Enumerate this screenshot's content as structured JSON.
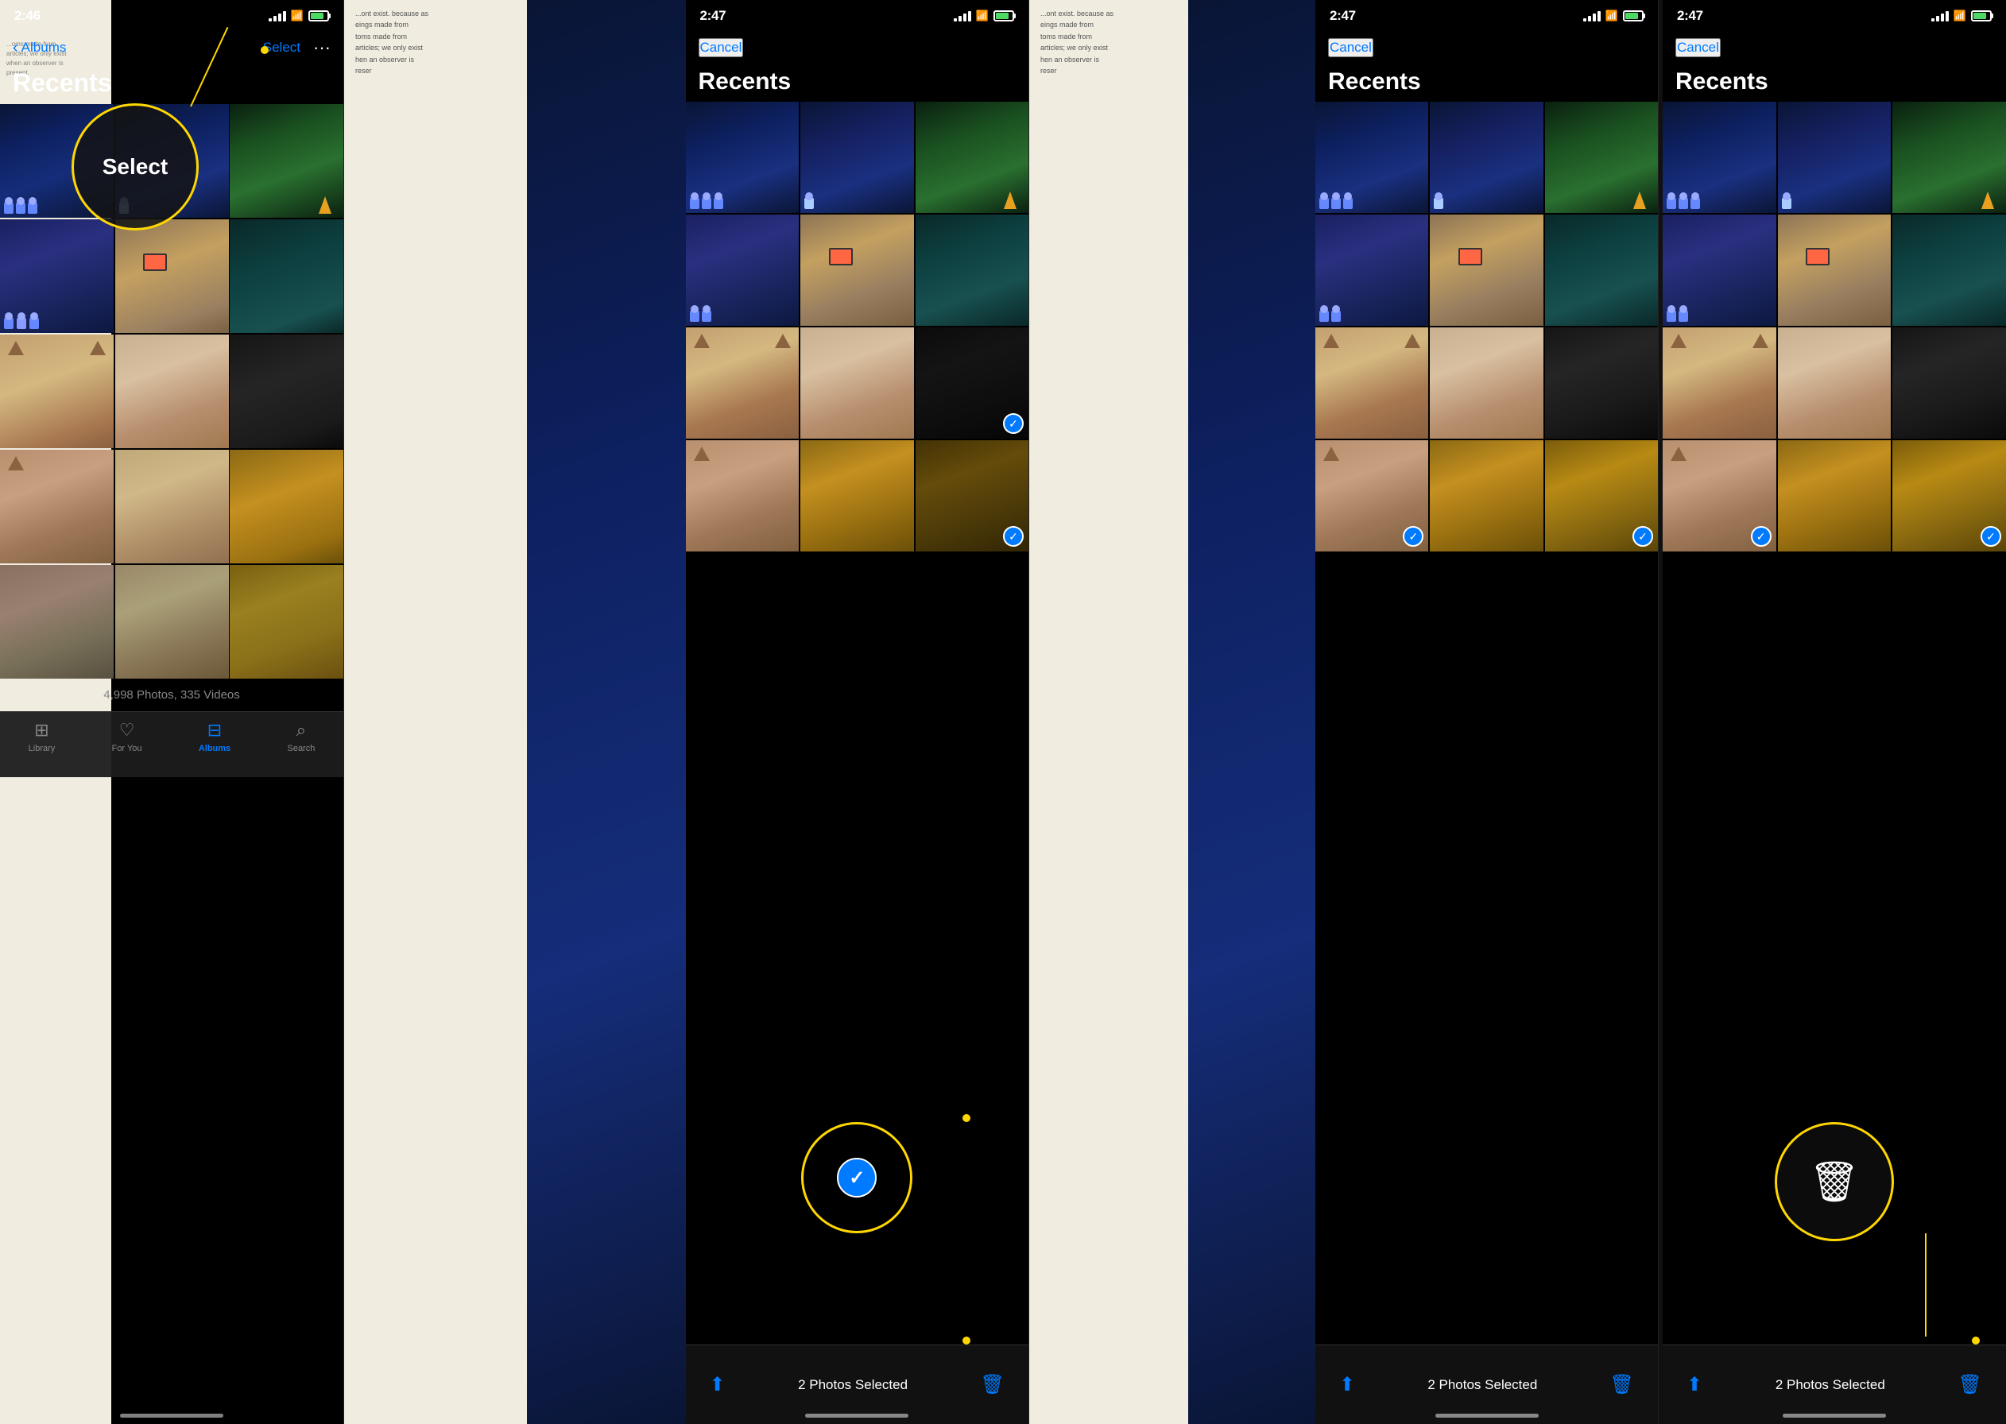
{
  "panels": [
    {
      "id": "panel1",
      "time": "2:46",
      "nav_back": "Albums",
      "title": "Recents",
      "select_btn": "Select",
      "dots_btn": "···",
      "photo_count": "4,998 Photos, 335 Videos",
      "tabs": [
        {
          "id": "library",
          "label": "Library",
          "icon": "⊞",
          "active": false
        },
        {
          "id": "for-you",
          "label": "For You",
          "icon": "♡",
          "active": false
        },
        {
          "id": "albums",
          "label": "Albums",
          "icon": "⊟",
          "active": true
        },
        {
          "id": "search",
          "label": "Search",
          "icon": "⌕",
          "active": false
        }
      ],
      "callout": {
        "text": "Select"
      }
    },
    {
      "id": "panel2",
      "time": "2:47",
      "nav_cancel": "Cancel",
      "title": "Recents",
      "action_label": "2 Photos Selected",
      "callout": {
        "type": "checkmark"
      }
    },
    {
      "id": "panel3",
      "time": "2:47",
      "nav_cancel": "Cancel",
      "title": "Recents",
      "action_label": "2 Photos Selected",
      "callout": {
        "type": "trash"
      }
    }
  ]
}
